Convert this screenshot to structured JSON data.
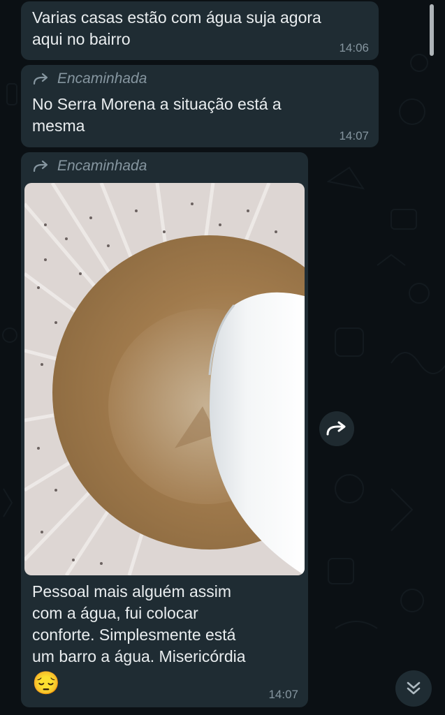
{
  "messages": [
    {
      "text": "Varias casas estão com água suja agora\naqui no bairro",
      "time": "14:06"
    },
    {
      "forwarded_label": "Encaminhada",
      "text": "No Serra Morena a situação está a\nmesma",
      "time": "14:07"
    },
    {
      "forwarded_label": "Encaminhada",
      "image_icon": "photo-muddy-water-tank",
      "caption": "Pessoal mais alguém assim\ncom a água, fui colocar\nconforte. Simplesmente está\num barro a água. Misericórdia",
      "emoji": "😔",
      "time": "14:07"
    }
  ],
  "icons": {
    "forward": "forward-arrow-icon",
    "share": "share-forward-icon",
    "scroll_down": "double-chevron-down-icon"
  },
  "colors": {
    "bubble": "#1f2c33",
    "background": "#0b1014",
    "meta_text": "#8696a0"
  }
}
